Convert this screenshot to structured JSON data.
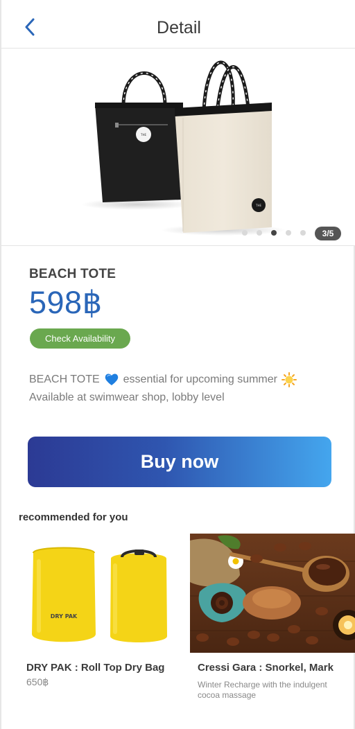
{
  "header": {
    "title": "Detail"
  },
  "gallery": {
    "counter": "3/5",
    "current_index": 3,
    "total": 5
  },
  "product": {
    "name": "BEACH TOTE",
    "price": "598฿",
    "availability_label": "Check Availability",
    "description_line1_part1": "BEACH TOTE",
    "description_line1_part2": "essential for upcoming summer",
    "description_line2": "Available at swimwear shop, lobby level",
    "icons": [
      "blue-heart-icon",
      "sun-icon"
    ]
  },
  "buy": {
    "label": "Buy now"
  },
  "recommended": {
    "title": "recommended for you",
    "items": [
      {
        "title": "DRY PAK : Roll Top Dry Bag",
        "price": "650฿",
        "logo_text": "DRY PAK"
      },
      {
        "title": "Cressi Gara : Snorkel, Mark",
        "description": "Winter Recharge with the indulgent cocoa massage"
      }
    ]
  },
  "colors": {
    "price": "#2a66b8",
    "availability_button": "#6aa84f",
    "buy_gradient_start": "#2c3a94",
    "buy_gradient_end": "#44a6ee",
    "back_arrow": "#2a66b8"
  }
}
